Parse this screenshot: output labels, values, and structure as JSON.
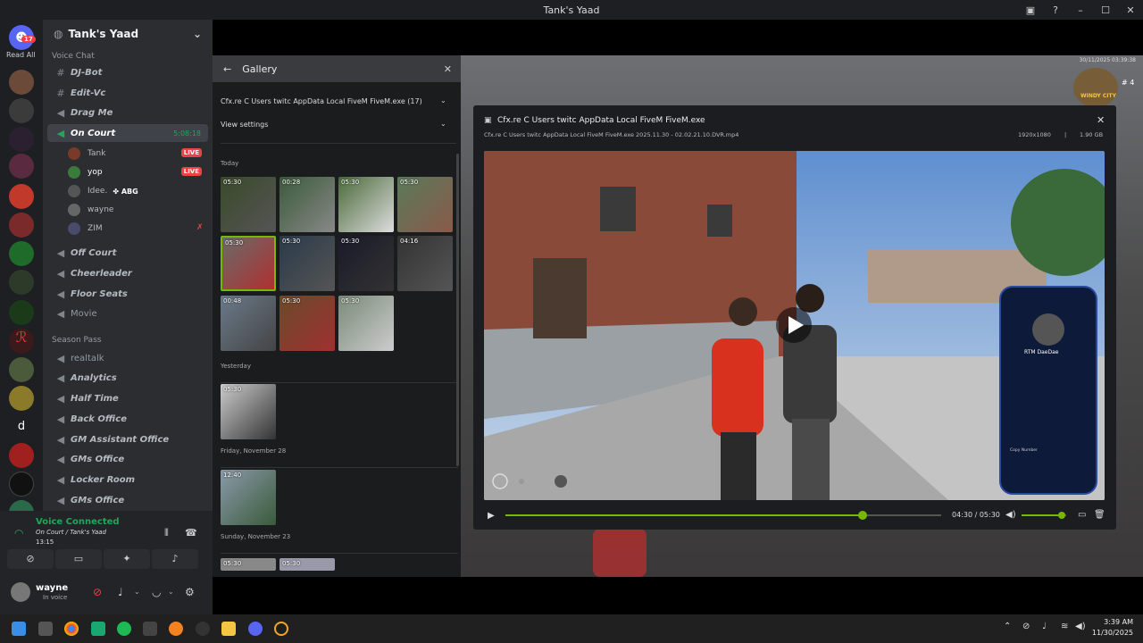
{
  "window": {
    "title": "Tank's Yaad"
  },
  "rail": {
    "notif_count": "17",
    "read_all": "Read All",
    "letter_server": "d"
  },
  "server": {
    "name": "Tank's Yaad"
  },
  "voice_chat_category": "Voice Chat",
  "season_category": "Season Pass",
  "channels_top": [
    {
      "label": "DJ-Bot",
      "icon": "hash-icon"
    },
    {
      "label": "Edit-Vc",
      "icon": "hash-icon"
    },
    {
      "label": "Drag Me",
      "icon": "speaker-icon"
    }
  ],
  "active_channel": {
    "label": "On Court",
    "timer": "5:08:18"
  },
  "voice_users": [
    {
      "name": "Tank",
      "live": "LIVE"
    },
    {
      "name": "yop",
      "live": "LIVE"
    },
    {
      "name": "Idee.",
      "tag": "ABG"
    },
    {
      "name": "wayne"
    },
    {
      "name": "ZIM"
    }
  ],
  "channels_mid": [
    {
      "label": "Off Court"
    },
    {
      "label": "Cheerleader"
    },
    {
      "label": "Floor Seats"
    },
    {
      "label": "Movie"
    }
  ],
  "channels_season": [
    {
      "label": "realtalk",
      "italic": false
    },
    {
      "label": "Analytics"
    },
    {
      "label": "Half Time"
    },
    {
      "label": "Back Office"
    },
    {
      "label": "GM Assistant Office"
    },
    {
      "label": "GMs Office"
    },
    {
      "label": "Locker Room"
    },
    {
      "label": "GMs Office"
    }
  ],
  "voice_panel": {
    "status": "Voice Connected",
    "location": "On Court / Tank's Yaad",
    "time": "13:15"
  },
  "user_panel": {
    "name": "wayne",
    "status": "In voice"
  },
  "gallery": {
    "title": "Gallery",
    "source_select": "Cfx.re C Users twitc AppData Local FiveM FiveM.exe (17)",
    "view_settings": "View settings",
    "sections": [
      {
        "label": "Today",
        "thumbs": [
          "05:30",
          "00:28",
          "05:30",
          "05:30",
          "05:30",
          "05:30",
          "05:30",
          "04:16",
          "00:48",
          "05:30",
          "05:30"
        ]
      },
      {
        "label": "Yesterday",
        "thumbs": [
          "05:30"
        ]
      },
      {
        "label": "Friday, November 28",
        "thumbs": [
          "12:40"
        ]
      },
      {
        "label": "Sunday, November 23",
        "thumbs": [
          "05:30",
          "05:30"
        ]
      }
    ]
  },
  "viewer": {
    "title": "Cfx.re C Users twitc AppData Local FiveM FiveM.exe",
    "filename": "Cfx.re C Users twitc AppData Local FiveM FiveM.exe 2025.11.30 - 02.02.21.10.DVR.mp4",
    "resolution": "1920x1080",
    "separator": "|",
    "size": "1.90 GB",
    "time": "04:30 / 05:30",
    "progress": 0.82,
    "volume": 0.9
  },
  "hud": {
    "date": "30/11/2025 03:39:38",
    "num": "# 4",
    "city": "WINDY CITY"
  },
  "phone": {
    "contact": "RTM DaeDae",
    "copy": "Copy Number"
  },
  "taskbar": {
    "time": "3:39 AM",
    "date": "11/30/2025"
  }
}
